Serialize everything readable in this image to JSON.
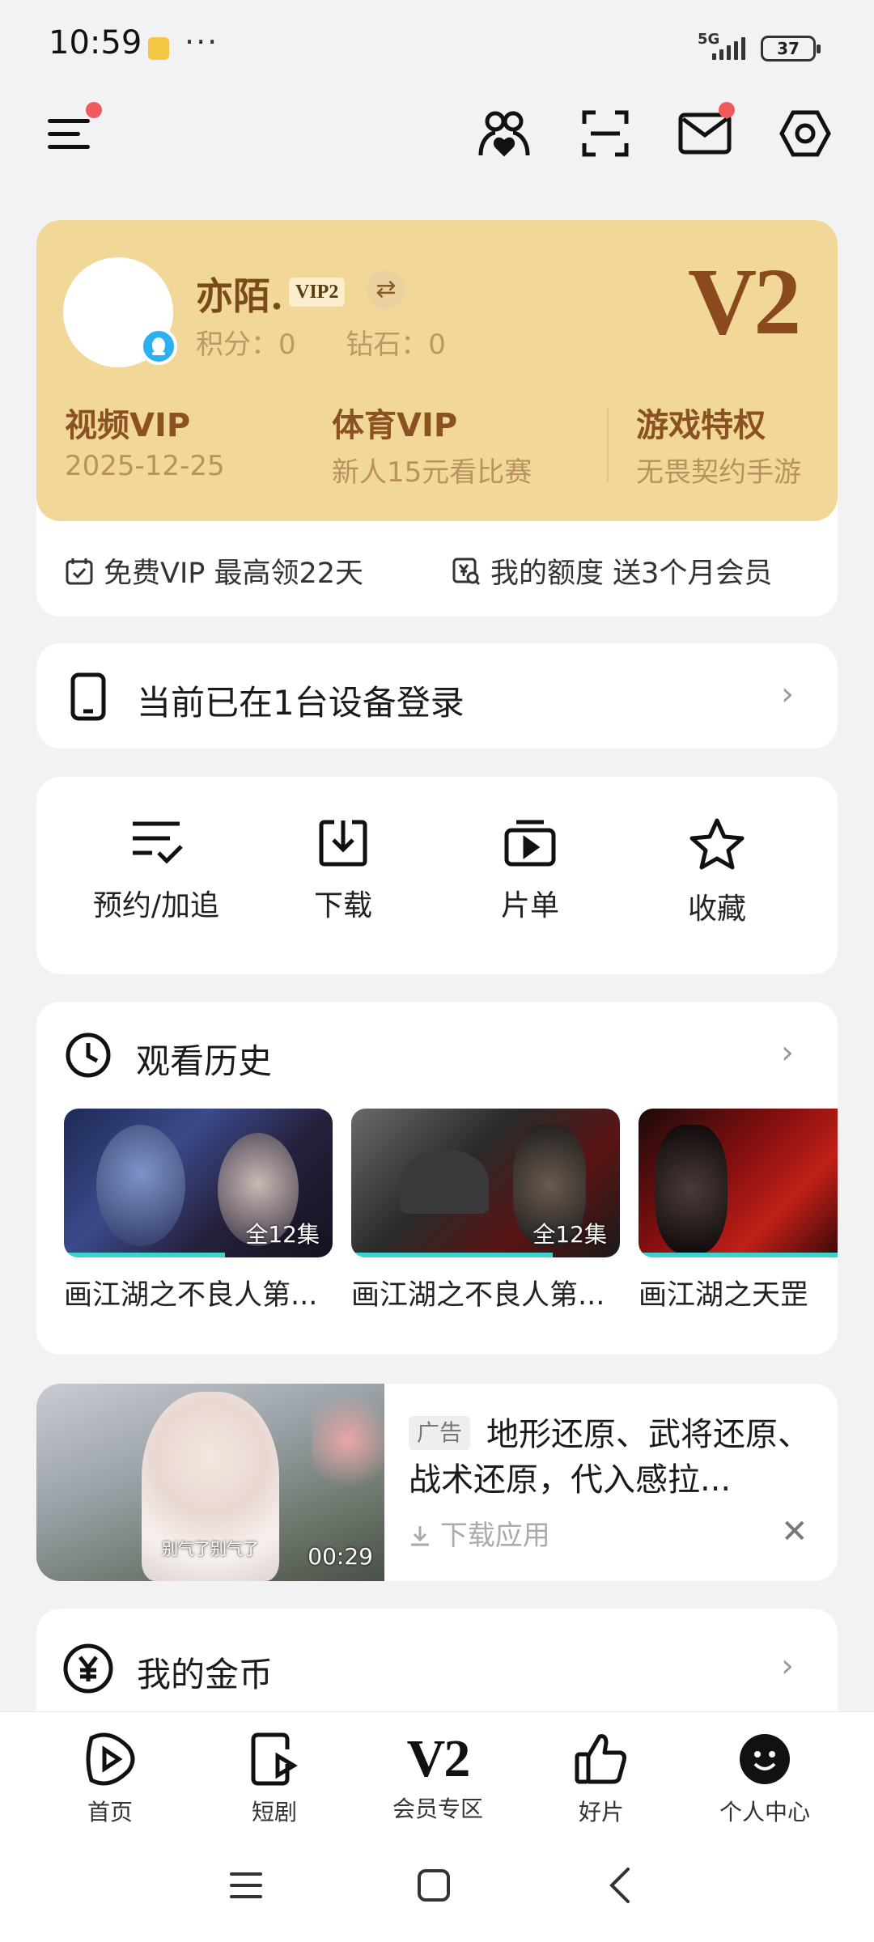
{
  "status": {
    "time": "10:59",
    "more": "···",
    "network": "5G",
    "battery": "37"
  },
  "user": {
    "name": "亦陌.",
    "vip_badge": "VIP2",
    "points_label": "积分：0",
    "diamonds_label": "钻石：0",
    "level": "V2"
  },
  "privileges": [
    {
      "title": "视频VIP",
      "subtitle": "2025-12-25"
    },
    {
      "title": "体育VIP",
      "subtitle": "新人15元看比赛"
    },
    {
      "title": "游戏特权",
      "subtitle": "无畏契约手游"
    }
  ],
  "vip_links": {
    "free_vip": "免费VIP 最高领22天",
    "quota": "我的额度 送3个月会员"
  },
  "device": {
    "label": "当前已在1台设备登录"
  },
  "quick_actions": [
    {
      "label": "预约/加追",
      "icon": "list-check-icon"
    },
    {
      "label": "下载",
      "icon": "download-icon"
    },
    {
      "label": "片单",
      "icon": "playlist-icon"
    },
    {
      "label": "收藏",
      "icon": "star-icon"
    }
  ],
  "history": {
    "title": "观看历史",
    "items": [
      {
        "title": "画江湖之不良人第...",
        "episodes": "全12集",
        "progress": 0.6
      },
      {
        "title": "画江湖之不良人第...",
        "episodes": "全12集",
        "progress": 0.75
      },
      {
        "title": "画江湖之天罡",
        "episodes": "",
        "progress": 1.0
      }
    ]
  },
  "ad": {
    "tag": "广告",
    "text": "地形还原、武将还原、战术还原，代入感拉...",
    "download": "下载应用",
    "caption": "别气了别气了",
    "duration": "00:29"
  },
  "coins": {
    "label": "我的金币"
  },
  "bottom_nav": [
    {
      "label": "首页",
      "icon": "home-play-icon"
    },
    {
      "label": "短剧",
      "icon": "short-drama-icon"
    },
    {
      "label": "会员专区",
      "icon": "v2-icon",
      "glyph": "V2"
    },
    {
      "label": "好片",
      "icon": "thumbs-up-icon"
    },
    {
      "label": "个人中心",
      "icon": "profile-icon"
    }
  ],
  "colors": {
    "vip_gold": "#f2d898",
    "vip_brown": "#8b4a1e",
    "progress": "#3dd2d0",
    "badge_red": "#f05a5a"
  }
}
